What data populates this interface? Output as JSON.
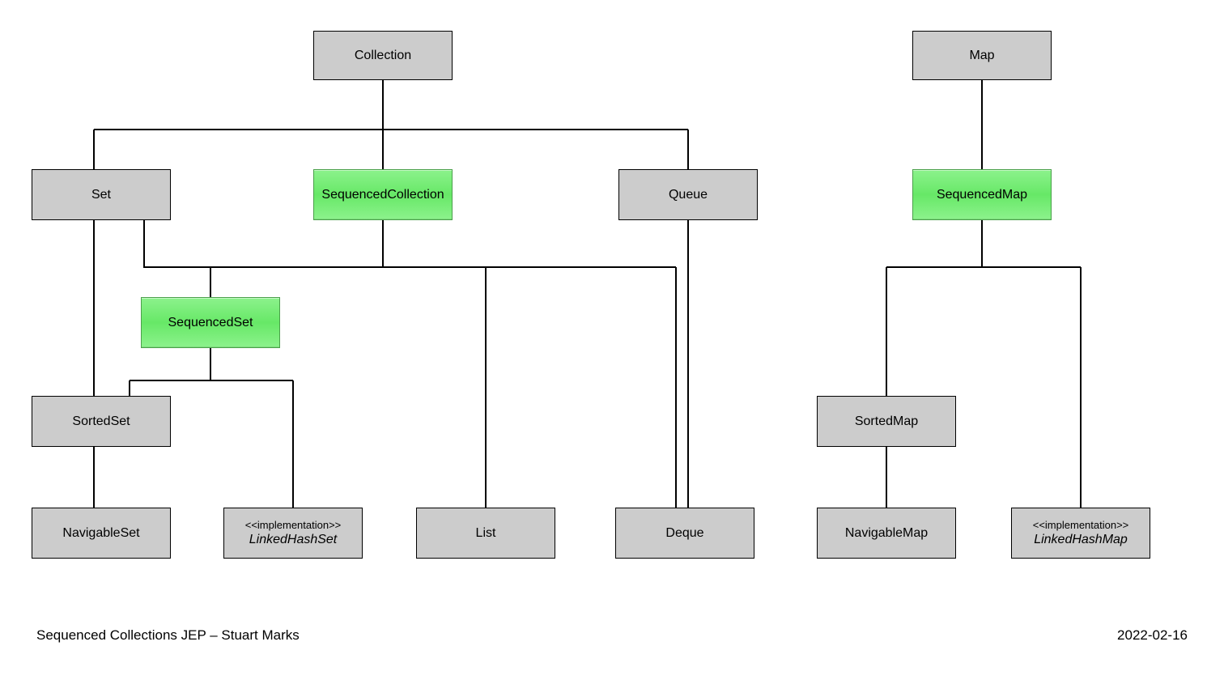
{
  "nodes": {
    "collection": {
      "label": "Collection"
    },
    "map": {
      "label": "Map"
    },
    "set": {
      "label": "Set"
    },
    "seqcoll": {
      "label": "SequencedCollection"
    },
    "queue": {
      "label": "Queue"
    },
    "seqmap": {
      "label": "SequencedMap"
    },
    "seqset": {
      "label": "SequencedSet"
    },
    "sortedset": {
      "label": "SortedSet"
    },
    "sortedmap": {
      "label": "SortedMap"
    },
    "navset": {
      "label": "NavigableSet"
    },
    "lhs_stereotype": "<<implementation>>",
    "lhs_name": "LinkedHashSet",
    "list": {
      "label": "List"
    },
    "deque": {
      "label": "Deque"
    },
    "navmap": {
      "label": "NavigableMap"
    },
    "lhm_stereotype": "<<implementation>>",
    "lhm_name": "LinkedHashMap"
  },
  "footer": {
    "title": "Sequenced Collections JEP – Stuart Marks",
    "date": "2022-02-16"
  }
}
